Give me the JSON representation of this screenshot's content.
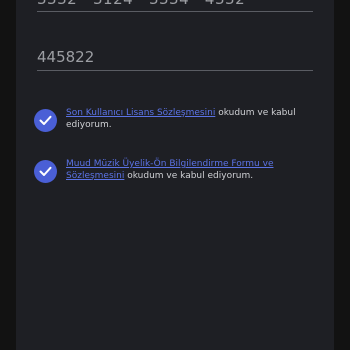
{
  "card_field": {
    "value": "3332 · 3124 · 3334 · 4332"
  },
  "cvv_field": {
    "value": "445822"
  },
  "consents": [
    {
      "link_text": "Son Kullanıcı Lisans Sözleşmesini",
      "suffix_text": " okudum ve kabul ediyorum.",
      "checked": true
    },
    {
      "link_text": "Muud Müzik Üyelik-Ön Bilgilendirme Formu ve Sözleşmesini",
      "suffix_text": " okudum ve kabul ediyorum.",
      "checked": true
    }
  ],
  "colors": {
    "accent": "#4a5fd6",
    "link": "#5b73e6",
    "panel_bg": "#1e1f24",
    "page_bg": "#121212"
  },
  "icons": {
    "checkbox": "check-icon"
  }
}
